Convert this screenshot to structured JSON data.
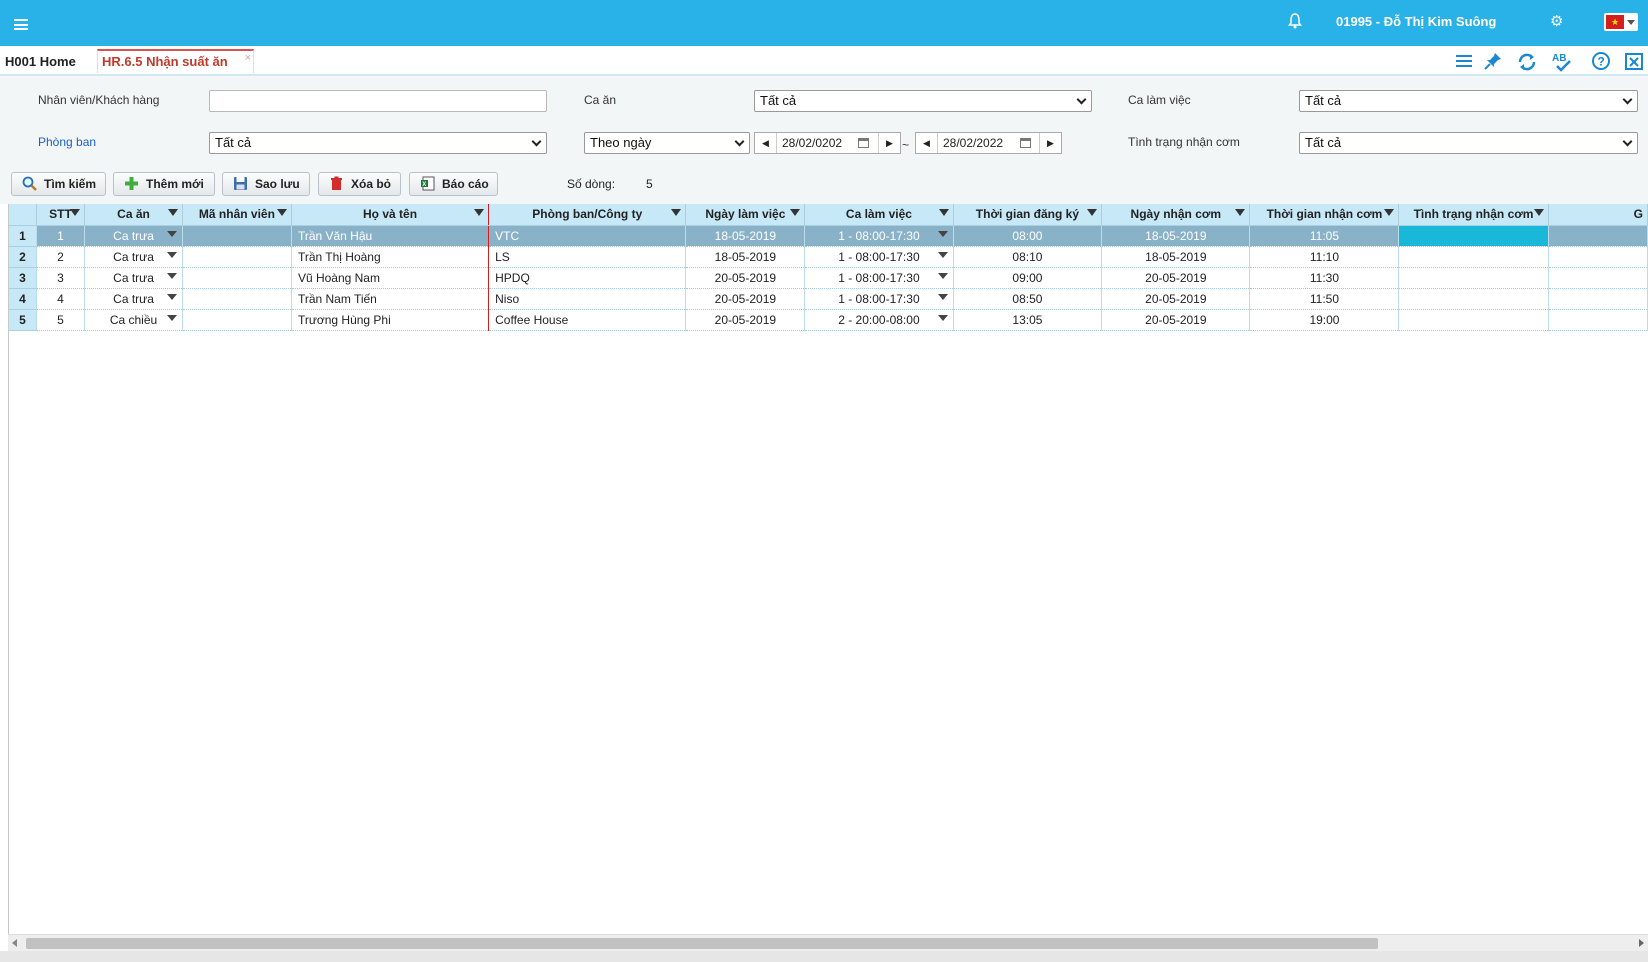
{
  "user_label": "01995 - Đỗ Thị Kim Suông",
  "tabs": [
    {
      "label": "H001 Home"
    },
    {
      "label": "HR.6.5 Nhận suất ăn",
      "close": "×"
    }
  ],
  "filters": {
    "employee_label": "Nhân viên/Khách hàng",
    "employee_value": "",
    "meal_label": "Ca ăn",
    "meal_value": "Tất cả",
    "shift_label": "Ca làm việc",
    "shift_value": "Tất cả",
    "department_label": "Phòng ban",
    "department_value": "Tất cả",
    "period_value": "Theo ngày",
    "date_from": "28/02/0202",
    "date_to": "28/02/2022",
    "date_separator": "~",
    "status_label": "Tình trạng nhận cơm",
    "status_value": "Tất cả"
  },
  "toolbar": {
    "search": "Tìm kiếm",
    "add": "Thêm mới",
    "save": "Sao lưu",
    "delete": "Xóa bỏ",
    "report": "Báo cáo",
    "rows_label": "Số dòng:",
    "rows_value": "5"
  },
  "grid": {
    "columns": [
      "STT",
      "Ca ăn",
      "Mã nhân viên",
      "Họ và tên",
      "Phòng ban/Công ty",
      "Ngày làm việc",
      "Ca làm việc",
      "Thời gian đăng ký",
      "Ngày nhận cơm",
      "Thời gian nhận cơm",
      "Tình trạng nhận cơm",
      "G"
    ],
    "rows": [
      {
        "rownum": "1",
        "stt": "1",
        "meal": "Ca trưa",
        "emp_id": "",
        "name": "Trần Văn Hậu",
        "dept": "VTC",
        "work_date": "18-05-2019",
        "shift": "1 - 08:00-17:30",
        "reg_time": "08:00",
        "receive_date": "18-05-2019",
        "receive_time": "11:05",
        "status": "",
        "extra": ""
      },
      {
        "rownum": "2",
        "stt": "2",
        "meal": "Ca trưa",
        "emp_id": "",
        "name": "Trần Thị Hoàng",
        "dept": "LS",
        "work_date": "18-05-2019",
        "shift": "1 - 08:00-17:30",
        "reg_time": "08:10",
        "receive_date": "18-05-2019",
        "receive_time": "11:10",
        "status": "",
        "extra": ""
      },
      {
        "rownum": "3",
        "stt": "3",
        "meal": "Ca trưa",
        "emp_id": "",
        "name": "Vũ Hoàng Nam",
        "dept": "HPDQ",
        "work_date": "20-05-2019",
        "shift": "1 - 08:00-17:30",
        "reg_time": "09:00",
        "receive_date": "20-05-2019",
        "receive_time": "11:30",
        "status": "",
        "extra": ""
      },
      {
        "rownum": "4",
        "stt": "4",
        "meal": "Ca trưa",
        "emp_id": "",
        "name": "Trần Nam Tiến",
        "dept": "Niso",
        "work_date": "20-05-2019",
        "shift": "1 - 08:00-17:30",
        "reg_time": "08:50",
        "receive_date": "20-05-2019",
        "receive_time": "11:50",
        "status": "",
        "extra": ""
      },
      {
        "rownum": "5",
        "stt": "5",
        "meal": "Ca chiều",
        "emp_id": "",
        "name": "Trương Hùng Phi",
        "dept": "Coffee House",
        "work_date": "20-05-2019",
        "shift": "2 - 20:00-08:00",
        "reg_time": "13:05",
        "receive_date": "20-05-2019",
        "receive_time": "19:00",
        "status": "",
        "extra": ""
      }
    ]
  },
  "colors": {
    "topbar": "#29b2e8",
    "header": "#c7e8f7",
    "selected_row": "#89b2c9",
    "status_highlight": "#19b7d8",
    "active_tab": "#c0392b"
  }
}
